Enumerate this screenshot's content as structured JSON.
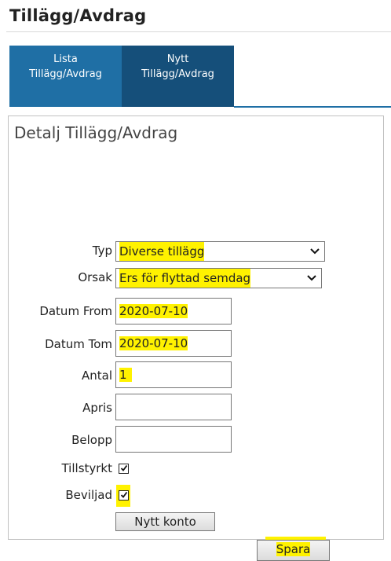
{
  "page": {
    "title": "Tillägg/Avdrag"
  },
  "tabs": [
    {
      "line1": "Lista",
      "line2": "Tillägg/Avdrag"
    },
    {
      "line1": "Nytt",
      "line2": "Tillägg/Avdrag"
    }
  ],
  "panel": {
    "title": "Detalj Tillägg/Avdrag"
  },
  "form": {
    "typ": {
      "label": "Typ",
      "value": "Diverse tillägg"
    },
    "orsak": {
      "label": "Orsak",
      "value": "Ers för flyttad semdag"
    },
    "datum_from": {
      "label": "Datum From",
      "value": "2020-07-10"
    },
    "datum_tom": {
      "label": "Datum Tom",
      "value": "2020-07-10"
    },
    "antal": {
      "label": "Antal",
      "value": "1"
    },
    "apris": {
      "label": "Apris",
      "value": ""
    },
    "belopp": {
      "label": "Belopp",
      "value": ""
    },
    "tillstyrkt": {
      "label": "Tillstyrkt",
      "checked": true
    },
    "beviljad": {
      "label": "Beviljad",
      "checked": true
    },
    "nytt_konto_label": "Nytt konto",
    "spara_label": "Spara"
  },
  "colors": {
    "tab_active": "#154f7a",
    "tab": "#1f6fa5",
    "highlight": "#fff200"
  }
}
